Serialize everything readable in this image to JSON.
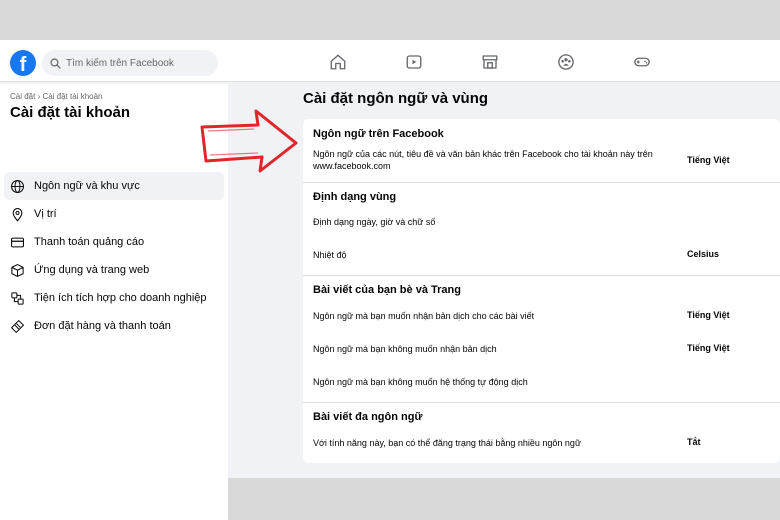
{
  "header": {
    "logo_letter": "f",
    "search_placeholder": "Tìm kiếm trên Facebook",
    "nav_icons": [
      "home-icon",
      "watch-icon",
      "marketplace-icon",
      "groups-icon",
      "gaming-icon"
    ]
  },
  "sidebar": {
    "breadcrumb": "Cài đặt › Cài đặt tài khoản",
    "title": "Cài đặt tài khoản",
    "items": [
      {
        "label": "Ngôn ngữ và khu vực",
        "icon": "globe-icon",
        "active": true
      },
      {
        "label": "Vị trí",
        "icon": "location-pin-icon"
      },
      {
        "label": "Thanh toán quảng cáo",
        "icon": "credit-card-icon"
      },
      {
        "label": "Ứng dụng và trang web",
        "icon": "cube-icon"
      },
      {
        "label": "Tiện ích tích hợp cho doanh nghiệp",
        "icon": "business-integration-icon"
      },
      {
        "label": "Đơn đặt hàng và thanh toán",
        "icon": "tag-icon"
      }
    ]
  },
  "main": {
    "title": "Cài đặt ngôn ngữ và vùng",
    "sections": [
      {
        "title": "Ngôn ngữ trên Facebook",
        "rows": [
          {
            "label": "Ngôn ngữ của các nút, tiêu đề và văn bản khác trên Facebook cho tài khoản này trên www.facebook.com",
            "value": "Tiếng Việt"
          }
        ]
      },
      {
        "title": "Định dạng vùng",
        "rows": [
          {
            "label": "Định dạng ngày, giờ và chữ số",
            "value": ""
          },
          {
            "label": "Nhiệt độ",
            "value": "Celsius"
          }
        ]
      },
      {
        "title": "Bài viết của bạn bè và Trang",
        "rows": [
          {
            "label": "Ngôn ngữ mà bạn muốn nhận bản dịch cho các bài viết",
            "value": "Tiếng Việt"
          },
          {
            "label": "Ngôn ngữ mà bạn không muốn nhận bản dịch",
            "value": "Tiếng Việt"
          },
          {
            "label": "Ngôn ngữ mà bạn không muốn hệ thống tự động dịch",
            "value": ""
          }
        ]
      },
      {
        "title": "Bài viết đa ngôn ngữ",
        "rows": [
          {
            "label": "Với tính năng này, bạn có thể đăng trạng thái bằng nhiều ngôn ngữ",
            "value": "Tắt"
          }
        ]
      }
    ]
  },
  "colors": {
    "brand": "#1877f2",
    "annotation_arrow": "#e0262b",
    "page_bg": "#f0f2f5"
  }
}
